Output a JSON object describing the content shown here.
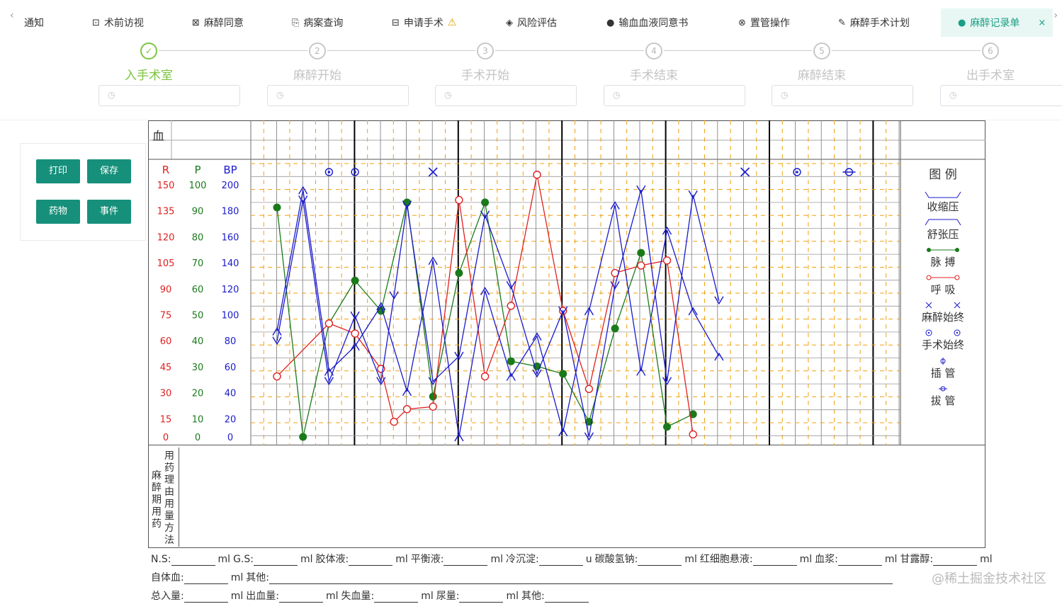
{
  "tabs": [
    {
      "label": "通知",
      "icon": "notice-icon",
      "x": 34
    },
    {
      "label": "术前访视",
      "icon": "image-frame-icon",
      "x": 130
    },
    {
      "label": "麻醉同意",
      "icon": "scan-icon",
      "x": 271
    },
    {
      "label": "病案查询",
      "icon": "folder-icon",
      "x": 412
    },
    {
      "label": "申请手术",
      "icon": "door-icon",
      "x": 553,
      "warning": "⚠"
    },
    {
      "label": "风险评估",
      "icon": "diamond-icon",
      "x": 714
    },
    {
      "label": "输血血液同意书",
      "icon": "drop-icon",
      "x": 856
    },
    {
      "label": "置管操作",
      "icon": "gear-circle-icon",
      "x": 1042
    },
    {
      "label": "麻醉手术计划",
      "icon": "pen-icon",
      "x": 1183
    }
  ],
  "active_tab": {
    "label": "麻醉记录单",
    "icon": "record-icon",
    "close": "×"
  },
  "steps": [
    {
      "num": "✓",
      "title": "入手术室",
      "done": true
    },
    {
      "num": "2",
      "title": "麻醉开始",
      "done": false
    },
    {
      "num": "3",
      "title": "手术开始",
      "done": false
    },
    {
      "num": "4",
      "title": "手术结束",
      "done": false
    },
    {
      "num": "5",
      "title": "麻醉结束",
      "done": false
    },
    {
      "num": "6",
      "title": "出手术室",
      "done": false
    }
  ],
  "buttons": {
    "print": "打印",
    "save": "保存",
    "drug": "药物",
    "event": "事件"
  },
  "chart": {
    "blood_label": "血",
    "axis_headers": {
      "r": "R",
      "p": "P",
      "bp": "BP"
    },
    "r_ticks": [
      "150",
      "135",
      "120",
      "105",
      "90",
      "75",
      "60",
      "45",
      "30",
      "15",
      "0"
    ],
    "p_ticks": [
      "100",
      "90",
      "80",
      "70",
      "60",
      "50",
      "40",
      "30",
      "20",
      "10",
      "0"
    ],
    "bp_ticks": [
      "200",
      "180",
      "160",
      "140",
      "120",
      "100",
      "80",
      "60",
      "40",
      "20",
      "0"
    ],
    "legend_title": "图 例",
    "legend": [
      "收缩压",
      "舒张压",
      "脉 搏",
      "呼 吸",
      "麻醉始终",
      "手术始终",
      "插 管",
      "拔 管"
    ],
    "colors": {
      "r": "#e02020",
      "p": "#1a7a1a",
      "bp": "#1a1acc",
      "grid_minor": "#f0a010"
    }
  },
  "chart_data": {
    "type": "line",
    "x": [
      1,
      2,
      3,
      4,
      5,
      6,
      7,
      8,
      9,
      10,
      11,
      12,
      13,
      14,
      15,
      16,
      17,
      18,
      19,
      20,
      21,
      22,
      23,
      24,
      25,
      26,
      27,
      28
    ],
    "series": [
      {
        "name": "脉 搏",
        "axis": "P",
        "x": [
          1,
          2,
          3,
          4,
          5,
          6,
          7,
          8,
          9,
          10,
          11,
          12,
          13,
          14,
          15,
          16,
          17
        ],
        "values": [
          91,
          0,
          45,
          62,
          50,
          93,
          16,
          65,
          93,
          30,
          28,
          25,
          6,
          43,
          73,
          4,
          9
        ]
      },
      {
        "name": "呼 吸",
        "axis": "R",
        "x": [
          1,
          3,
          4,
          5,
          5.5,
          6,
          7,
          8,
          9,
          10,
          11,
          12,
          13,
          14,
          15,
          16,
          17
        ],
        "values": [
          24,
          45,
          41,
          27,
          6,
          11,
          12,
          94,
          24,
          52,
          104,
          50,
          19,
          65,
          68,
          70,
          1
        ]
      },
      {
        "name": "收缩压",
        "axis": "BP",
        "x": [
          1,
          2,
          3,
          4,
          5,
          5.5,
          6,
          7,
          8,
          9,
          10,
          11,
          12,
          13,
          14,
          15,
          16,
          17,
          18
        ],
        "values": [
          38,
          94,
          22,
          48,
          22,
          56,
          92,
          22,
          32,
          88,
          60,
          25,
          50,
          0,
          60,
          98,
          22,
          96,
          54
        ]
      },
      {
        "name": "舒张压",
        "axis": "BP",
        "x": [
          1,
          2,
          3,
          4,
          5,
          6,
          7,
          8,
          9,
          10,
          11,
          12,
          13,
          14,
          15,
          16,
          17,
          18
        ],
        "values": [
          42,
          98,
          26,
          36,
          52,
          18,
          70,
          0,
          58,
          24,
          40,
          2,
          50,
          92,
          26,
          82,
          50,
          32
        ]
      }
    ],
    "markers": [
      {
        "type": "手术始终",
        "x": 3
      },
      {
        "type": "手术始终",
        "x": 4
      },
      {
        "type": "麻醉始终",
        "x": 7
      },
      {
        "type": "麻醉始终",
        "x": 19
      },
      {
        "type": "手术始终",
        "x": 21
      },
      {
        "type": "插 管",
        "x": 23
      }
    ]
  },
  "drug_section": {
    "label": "麻醉期用药",
    "sub": "用药理由用量方法"
  },
  "fluids_row1": [
    {
      "label": "N.S:",
      "unit": "ml"
    },
    {
      "label": "G.S:",
      "unit": "ml"
    },
    {
      "label": "胶体液:",
      "unit": "ml"
    },
    {
      "label": "平衡液:",
      "unit": "ml"
    },
    {
      "label": "冷沉淀:",
      "unit": "u"
    },
    {
      "label": "碳酸氢钠:",
      "unit": "ml"
    },
    {
      "label": "红细胞悬液:",
      "unit": "ml"
    },
    {
      "label": "血浆:",
      "unit": "ml"
    },
    {
      "label": "甘露醇:",
      "unit": "ml"
    }
  ],
  "fluids_row2": [
    {
      "label": "自体血:",
      "unit": "ml"
    },
    {
      "label": "其他:",
      "unit": ""
    }
  ],
  "fluids_row3": [
    {
      "label": "总入量:",
      "unit": "ml"
    },
    {
      "label": "出血量:",
      "unit": "ml"
    },
    {
      "label": "失血量:",
      "unit": "ml"
    },
    {
      "label": "尿量:",
      "unit": "ml"
    },
    {
      "label": "其他:",
      "unit": ""
    }
  ],
  "watermark": "@稀土掘金技术社区"
}
